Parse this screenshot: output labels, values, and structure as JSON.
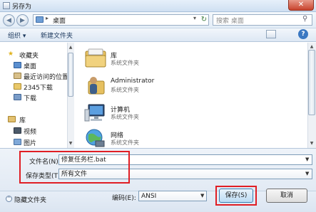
{
  "window": {
    "title": "另存为",
    "close_glyph": "✕"
  },
  "address": {
    "path": "桌面",
    "separator": "▸",
    "dropdown": "▾",
    "refresh_glyph": "↻"
  },
  "search": {
    "placeholder": "搜索 桌面",
    "icon": "search-icon"
  },
  "toolbar": {
    "organize": "组织 ▾",
    "new_folder": "新建文件夹",
    "help": "?"
  },
  "nav": {
    "groups": [
      {
        "label": "收藏夹",
        "items": [
          "桌面",
          "最近访问的位置",
          "2345下载",
          "下载"
        ]
      },
      {
        "label": "库",
        "items": [
          "视频",
          "图片"
        ]
      }
    ]
  },
  "content": {
    "items": [
      {
        "name": "库",
        "sub": "系统文件夹",
        "icon": "library-folder-icon"
      },
      {
        "name": "Administrator",
        "sub": "系统文件夹",
        "icon": "user-folder-icon"
      },
      {
        "name": "计算机",
        "sub": "系统文件夹",
        "icon": "computer-icon"
      },
      {
        "name": "网络",
        "sub": "系统文件夹",
        "icon": "network-icon"
      }
    ]
  },
  "form": {
    "filename_label": "文件名(N):",
    "filename_value": "修复任务栏.bat",
    "filetype_label": "保存类型(T):",
    "filetype_value": "所有文件",
    "arrow": "▼"
  },
  "footer": {
    "hide_folders": "隐藏文件夹",
    "hide_glyph": "^",
    "encoding_label": "编码(E):",
    "encoding_value": "ANSI",
    "save": "保存(S)",
    "cancel": "取消"
  },
  "colors": {
    "highlight": "#e01e24",
    "accent": "#3a78c2"
  }
}
